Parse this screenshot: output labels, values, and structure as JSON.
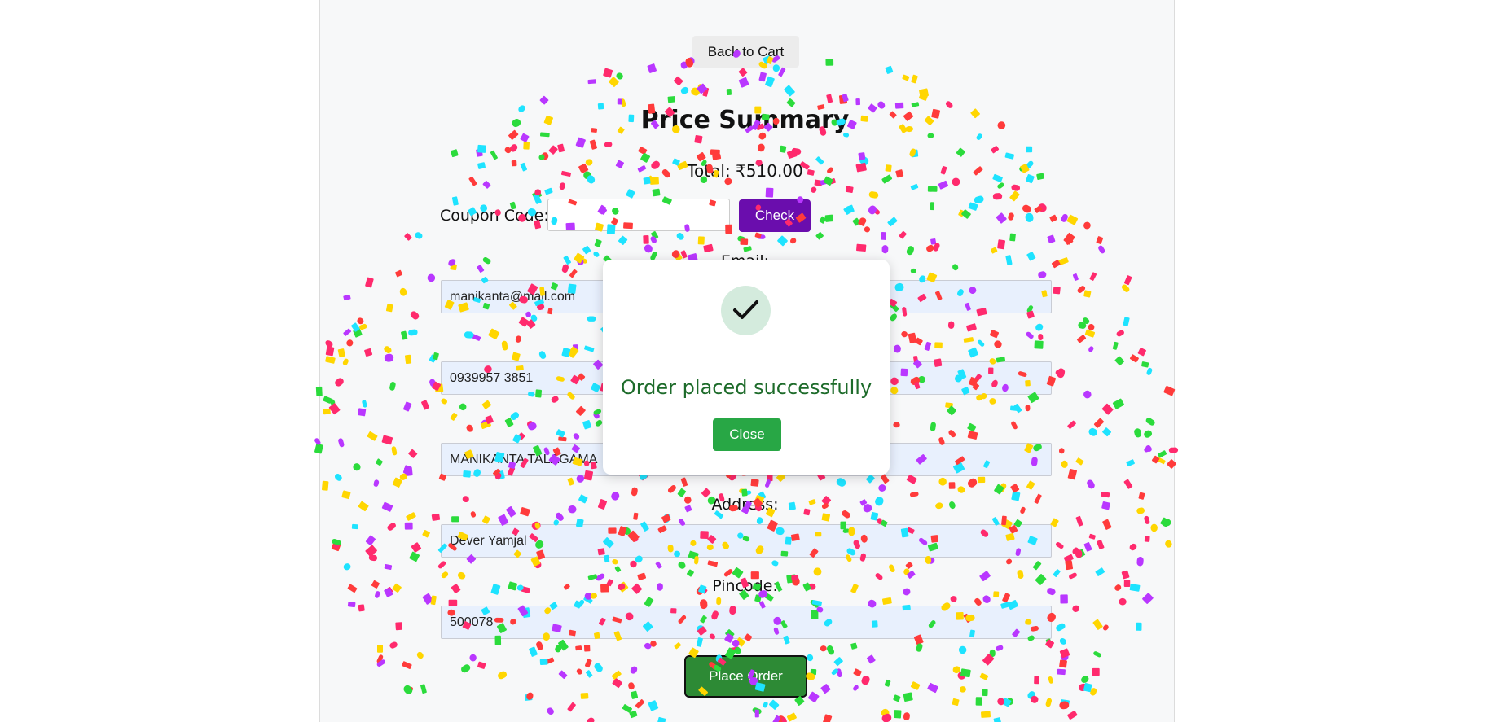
{
  "header": {
    "back_label": "Back to Cart"
  },
  "summary": {
    "title": "Price Summary",
    "total_text": "Total: ₹510.00"
  },
  "coupon": {
    "label": "Coupon Code:",
    "value": "",
    "check_label": "Check"
  },
  "form": {
    "email_label": "Email:",
    "email_value": "manikanta@mail.com",
    "phone_value": "0939957 3851",
    "name_value": "MANIKANTA TALAGAMA",
    "address_label": "Address:",
    "address_value": "Dever Yamjal",
    "pincode_label": "Pincode:",
    "pincode_value": "500078",
    "place_order_label": "Place Order"
  },
  "modal": {
    "icon": "checkmark-icon",
    "message": "Order placed successfully",
    "close_label": "Close"
  },
  "colors": {
    "accent_purple": "#6a0dad",
    "success_green": "#28a745",
    "place_order_green": "#2d8a35",
    "confetti": [
      "#ff2a6d",
      "#ffd600",
      "#1ee3ff",
      "#b937ff",
      "#2bdb3c",
      "#ff3b3b"
    ]
  }
}
